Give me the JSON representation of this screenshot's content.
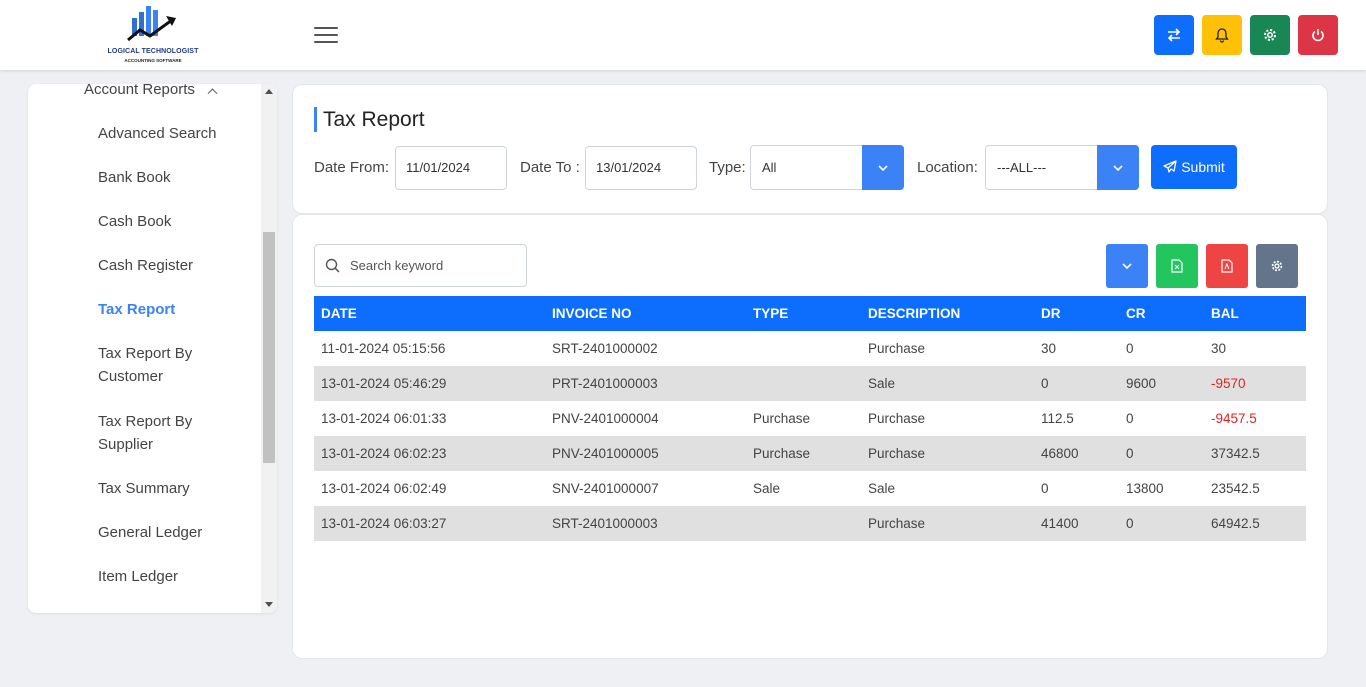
{
  "app": {
    "logo_title": "LOGICAL TECHNOLOGIST",
    "logo_subtitle": "ACCOUNTING SOFTWARE"
  },
  "header": {
    "buttons": [
      {
        "icon": "switch-icon",
        "color": "#0d6efd"
      },
      {
        "icon": "bell-icon",
        "color": "#ffc107"
      },
      {
        "icon": "gear-icon",
        "color": "#198754"
      },
      {
        "icon": "power-icon",
        "color": "#dc3545"
      }
    ]
  },
  "sidebar": {
    "group_label": "Account Reports",
    "items": [
      {
        "label": "Advanced Search"
      },
      {
        "label": "Bank Book"
      },
      {
        "label": "Cash Book"
      },
      {
        "label": "Cash Register"
      },
      {
        "label": "Tax Report",
        "active": true
      },
      {
        "label": "Tax Report By Customer"
      },
      {
        "label": "Tax Report By Supplier"
      },
      {
        "label": "Tax Summary"
      },
      {
        "label": "General Ledger"
      },
      {
        "label": "Item Ledger"
      }
    ]
  },
  "page": {
    "title": "Tax Report"
  },
  "filters": {
    "date_from_label": "Date From:",
    "date_from_value": "11/01/2024",
    "date_to_label": "Date To :",
    "date_to_value": "13/01/2024",
    "type_label": "Type:",
    "type_value": "All",
    "location_label": "Location:",
    "location_value": "---ALL---",
    "submit_label": "Submit"
  },
  "toolbar": {
    "search_placeholder": "Search keyword",
    "buttons": [
      {
        "icon": "chevron-down-icon",
        "color": "#3b82f6"
      },
      {
        "icon": "excel-icon",
        "color": "#22c55e"
      },
      {
        "icon": "pdf-icon",
        "color": "#ef4444"
      },
      {
        "icon": "gear-icon",
        "color": "#64748b"
      }
    ]
  },
  "table": {
    "columns": [
      "DATE",
      "INVOICE NO",
      "TYPE",
      "DESCRIPTION",
      "DR",
      "CR",
      "BAL"
    ],
    "rows": [
      [
        "11-01-2024 05:15:56",
        "SRT-2401000002",
        "",
        "Purchase",
        "30",
        "0",
        "30"
      ],
      [
        "13-01-2024 05:46:29",
        "PRT-2401000003",
        "",
        "Sale",
        "0",
        "9600",
        "-9570"
      ],
      [
        "13-01-2024 06:01:33",
        "PNV-2401000004",
        "Purchase",
        "Purchase",
        "112.5",
        "0",
        "-9457.5"
      ],
      [
        "13-01-2024 06:02:23",
        "PNV-2401000005",
        "Purchase",
        "Purchase",
        "46800",
        "0",
        "37342.5"
      ],
      [
        "13-01-2024 06:02:49",
        "SNV-2401000007",
        "Sale",
        "Sale",
        "0",
        "13800",
        "23542.5"
      ],
      [
        "13-01-2024 06:03:27",
        "SRT-2401000003",
        "",
        "Purchase",
        "41400",
        "0",
        "64942.5"
      ]
    ]
  }
}
